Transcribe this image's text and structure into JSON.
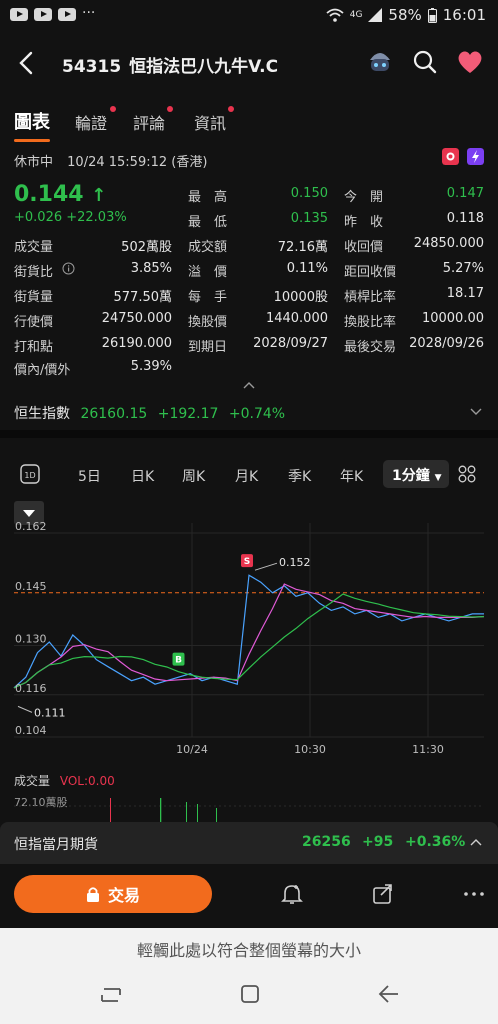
{
  "status": {
    "signal": "4G",
    "battery": "58%",
    "time": "16:01"
  },
  "header": {
    "code": "54315",
    "name": "恒指法巴八九牛V.C"
  },
  "tabs": [
    {
      "label": "圖表",
      "active": true,
      "dot": false
    },
    {
      "label": "輪證",
      "active": false,
      "dot": true
    },
    {
      "label": "評論",
      "active": false,
      "dot": true
    },
    {
      "label": "資訊",
      "active": false,
      "dot": true
    }
  ],
  "market_status": "休市中",
  "market_time": "10/24 15:59:12 (香港)",
  "price": "0.144",
  "change": "+0.026 +22.03%",
  "stats": {
    "high_label": "最　高",
    "high": "0.150",
    "open_label": "今　開",
    "open": "0.147",
    "low_label": "最　低",
    "low": "0.135",
    "prevclose_label": "昨　收",
    "prevclose": "0.118",
    "volume_label": "成交量",
    "volume": "502萬股",
    "turnover_label": "成交額",
    "turnover": "72.16萬",
    "callprice_label": "收回價",
    "callprice": "24850.000",
    "outstanding_label": "街貨比",
    "outstanding": "3.85%",
    "premium_label": "溢　價",
    "premium": "0.11%",
    "tocall_label": "距回收價",
    "tocall": "5.27%",
    "outqty_label": "街貨量",
    "outqty": "577.50萬",
    "lot_label": "每　手",
    "lot": "10000股",
    "gearing_label": "槓桿比率",
    "gearing": "18.17",
    "strike_label": "行使價",
    "strike": "24750.000",
    "conv_label": "換股價",
    "conv": "1440.000",
    "ratio_label": "換股比率",
    "ratio": "10000.00",
    "breakeven_label": "打和點",
    "breakeven": "26190.000",
    "expiry_label": "到期日",
    "expiry": "2028/09/27",
    "lasttrade_label": "最後交易",
    "lasttrade": "2028/09/26",
    "moneyness_label": "價內/價外",
    "moneyness": "5.39%"
  },
  "index": {
    "name": "恒生指數",
    "value": "26160.15",
    "change": "+192.17",
    "pct": "+0.74%"
  },
  "periods": [
    "5日",
    "日K",
    "周K",
    "月K",
    "季K",
    "年K"
  ],
  "period_selected": "1分鐘",
  "chart_data": {
    "type": "line",
    "x_ticks": [
      "10/24",
      "10:30",
      "11:30"
    ],
    "y_ticks": [
      "0.162",
      "0.145",
      "0.130",
      "0.116",
      "0.104"
    ],
    "ylim": [
      0.104,
      0.162
    ],
    "reference_line": 0.145,
    "annotations": [
      {
        "text": "0.152",
        "kind": "high"
      },
      {
        "text": "0.111",
        "kind": "low"
      },
      {
        "text": "S",
        "kind": "sell-marker"
      },
      {
        "text": "B",
        "kind": "buy-marker"
      }
    ],
    "series": [
      {
        "values": [
          0.118,
          0.121,
          0.128,
          0.131,
          0.127,
          0.133,
          0.13,
          0.126,
          0.124,
          0.122,
          0.12,
          0.121,
          0.119,
          0.12,
          0.121,
          0.122,
          0.12,
          0.121,
          0.12,
          0.119,
          0.15,
          0.148,
          0.145,
          0.147,
          0.144,
          0.145,
          0.142,
          0.14,
          0.141,
          0.139,
          0.14,
          0.138,
          0.139,
          0.137,
          0.138,
          0.139,
          0.138,
          0.137,
          0.138,
          0.139,
          0.139
        ]
      }
    ]
  },
  "volume": {
    "label": "成交量",
    "vol_label": "VOL:0.00",
    "max": "72.10萬股"
  },
  "futures": {
    "name": "恒指當月期貨",
    "value": "26256",
    "change": "+95",
    "pct": "+0.36%"
  },
  "trade_label": "交易",
  "fit_text": "輕觸此處以符合整個螢幕的大小",
  "colors": {
    "accent": "#f26b1d",
    "up": "#2fbf4d",
    "down": "#e8344e"
  }
}
